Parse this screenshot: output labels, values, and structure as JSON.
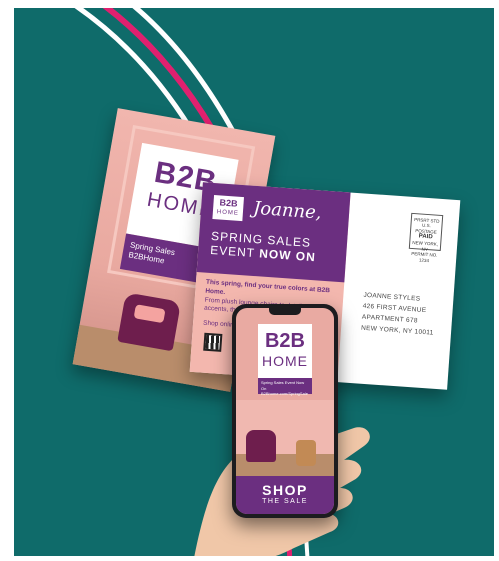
{
  "brand": {
    "name": "B2B",
    "sub": "HOME",
    "color_purple": "#6b2f80",
    "color_pink": "#f1b6ae",
    "color_teal": "#0f6b6a",
    "accent_stripe": "#e0206f"
  },
  "back_card": {
    "strip_text": "Spring Sales\nB2BHome"
  },
  "postcard": {
    "recipient_first": "Joanne,",
    "headline_line1": "SPRING SALES",
    "headline_line2_prefix": "EVENT ",
    "headline_line2_bold": "NOW ON",
    "body_bold": "This spring, find your true colors at B2B Home.",
    "body_text": "From plush lounge chairs to detailed pink accents, throws and more ... home offer ...",
    "body_text2": "Shop online ... of March ... sale priced",
    "stamp_lines": [
      "PRSRT STD",
      "U.S. POSTAGE",
      "PAID",
      "NEW YORK, NY",
      "PERMIT NO. 1234"
    ],
    "address_lines": [
      "JOANNE STYLES",
      "426 FIRST AVENUE",
      "APARTMENT 678",
      "NEW YORK, NY 10011"
    ]
  },
  "phone": {
    "logo_b2b": "B2B",
    "logo_home": "HOME",
    "strip_text": "Spring Sales Event Now On\nB2Bhome.com/SpringSale",
    "cta_line1": "SHOP",
    "cta_line2": "THE SALE"
  }
}
